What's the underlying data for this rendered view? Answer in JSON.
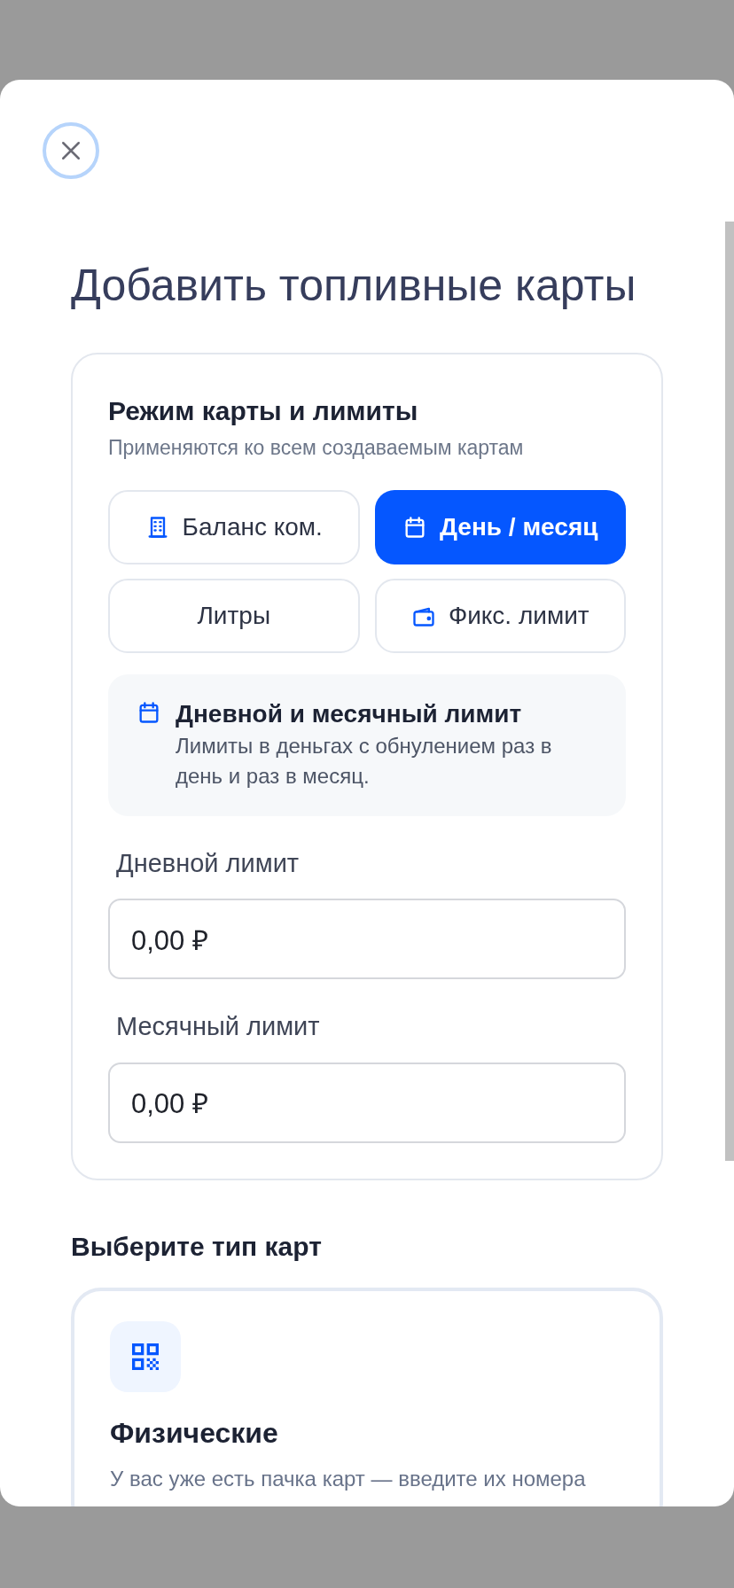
{
  "modal": {
    "title": "Добавить топливные карты"
  },
  "limits_card": {
    "title": "Режим карты и лимиты",
    "subtitle": "Применяются ко всем создаваемым картам",
    "modes": [
      {
        "label": "Баланс ком.",
        "selected": false
      },
      {
        "label": "День / месяц",
        "selected": true
      },
      {
        "label": "Литры",
        "selected": false
      },
      {
        "label": "Фикс. лимит",
        "selected": false
      }
    ],
    "info": {
      "title": "Дневной и месячный лимит",
      "text": "Лимиты в деньгах с обнулением раз в день и раз в месяц."
    },
    "fields": [
      {
        "label": "Дневной лимит",
        "value": "0,00 ₽"
      },
      {
        "label": "Месячный лимит",
        "value": "0,00 ₽"
      }
    ]
  },
  "card_types": {
    "title": "Выберите тип карт",
    "items": [
      {
        "title": "Физические",
        "description": "У вас уже есть пачка карт — введите их номера"
      }
    ]
  }
}
